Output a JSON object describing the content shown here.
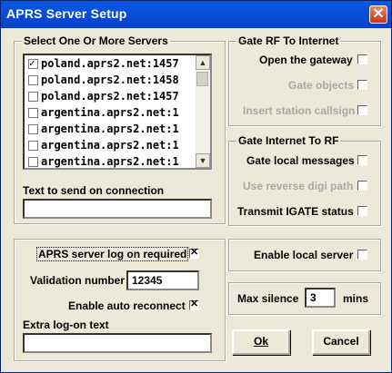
{
  "window": {
    "title": "APRS Server Setup",
    "close_glyph": "✕"
  },
  "servers": {
    "legend": "Select One Or More Servers",
    "items": [
      {
        "label": "poland.aprs2.net:1457",
        "checked": true
      },
      {
        "label": "poland.aprs2.net:1458",
        "checked": false
      },
      {
        "label": "poland.aprs2.net:1457",
        "checked": false
      },
      {
        "label": "argentina.aprs2.net:1",
        "checked": false
      },
      {
        "label": "argentina.aprs2.net:1",
        "checked": false
      },
      {
        "label": "argentina.aprs2.net:1",
        "checked": false
      },
      {
        "label": "argentina.aprs2.net:1",
        "checked": false
      }
    ],
    "scroll_up": "▲",
    "scroll_down": "▼",
    "connect_text_label": "Text to send on connection",
    "connect_text_value": ""
  },
  "rf_to_inet": {
    "legend": "Gate RF To Internet",
    "open_gateway": "Open the gateway",
    "gate_objects": "Gate objects",
    "insert_callsign": "Insert station callsign"
  },
  "inet_to_rf": {
    "legend": "Gate Internet To RF",
    "gate_local": "Gate local messages",
    "reverse_digi": "Use reverse digi path",
    "transmit_igate": "Transmit IGATE status"
  },
  "logon": {
    "required_label": "APRS server log on required",
    "validation_label": "Validation number",
    "validation_value": "12345",
    "auto_reconnect_label": "Enable auto reconnect",
    "extra_label": "Extra log-on text",
    "extra_value": ""
  },
  "local_server": {
    "label": "Enable local server"
  },
  "max_silence": {
    "label": "Max silence",
    "value": "3",
    "unit": "mins"
  },
  "buttons": {
    "ok": "Ok",
    "cancel": "Cancel"
  }
}
